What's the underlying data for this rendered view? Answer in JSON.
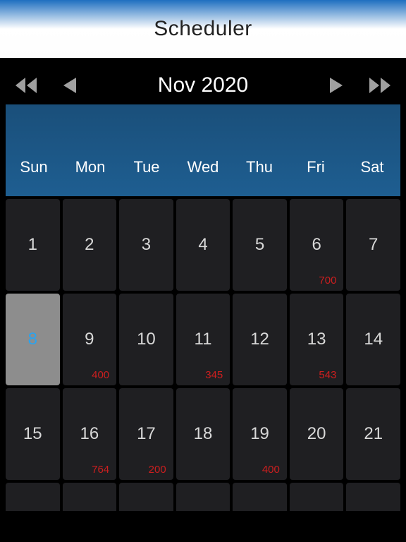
{
  "title": "Scheduler",
  "nav": {
    "month_label": "Nov 2020"
  },
  "weekdays": [
    "Sun",
    "Mon",
    "Tue",
    "Wed",
    "Thu",
    "Fri",
    "Sat"
  ],
  "days": [
    {
      "n": "1",
      "badge": null,
      "selected": false
    },
    {
      "n": "2",
      "badge": null,
      "selected": false
    },
    {
      "n": "3",
      "badge": null,
      "selected": false
    },
    {
      "n": "4",
      "badge": null,
      "selected": false
    },
    {
      "n": "5",
      "badge": null,
      "selected": false
    },
    {
      "n": "6",
      "badge": "700",
      "selected": false
    },
    {
      "n": "7",
      "badge": null,
      "selected": false
    },
    {
      "n": "8",
      "badge": null,
      "selected": true
    },
    {
      "n": "9",
      "badge": "400",
      "selected": false
    },
    {
      "n": "10",
      "badge": null,
      "selected": false
    },
    {
      "n": "11",
      "badge": "345",
      "selected": false
    },
    {
      "n": "12",
      "badge": null,
      "selected": false
    },
    {
      "n": "13",
      "badge": "543",
      "selected": false
    },
    {
      "n": "14",
      "badge": null,
      "selected": false
    },
    {
      "n": "15",
      "badge": null,
      "selected": false
    },
    {
      "n": "16",
      "badge": "764",
      "selected": false
    },
    {
      "n": "17",
      "badge": "200",
      "selected": false
    },
    {
      "n": "18",
      "badge": null,
      "selected": false
    },
    {
      "n": "19",
      "badge": "400",
      "selected": false
    },
    {
      "n": "20",
      "badge": null,
      "selected": false
    },
    {
      "n": "21",
      "badge": null,
      "selected": false
    }
  ],
  "partial_count": 7
}
